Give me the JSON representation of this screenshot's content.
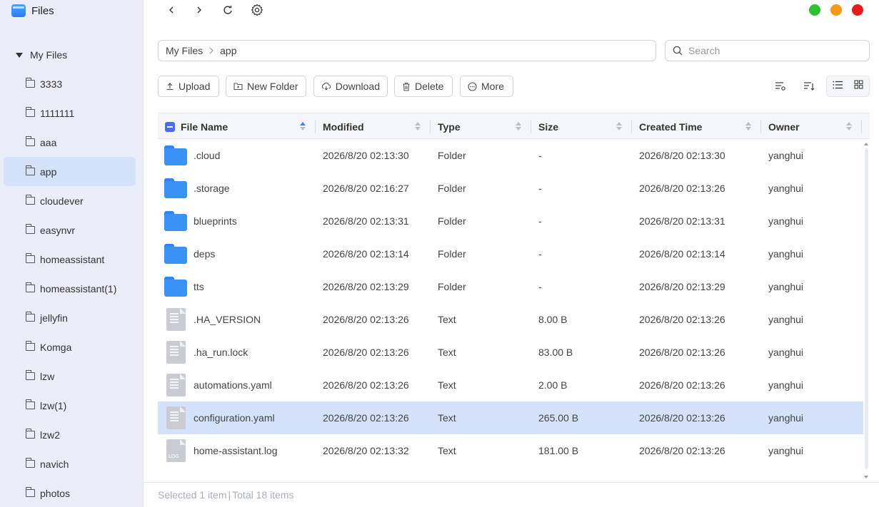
{
  "app": {
    "title": "Files"
  },
  "window_controls": [
    {
      "name": "green",
      "color": "#2fc02f"
    },
    {
      "name": "orange",
      "color": "#f59a16"
    },
    {
      "name": "red",
      "color": "#e81b1b"
    }
  ],
  "sidebar": {
    "root_label": "My Files",
    "items": [
      {
        "label": "3333",
        "active": false
      },
      {
        "label": "1111111",
        "active": false
      },
      {
        "label": "aaa",
        "active": false
      },
      {
        "label": "app",
        "active": true
      },
      {
        "label": "cloudever",
        "active": false
      },
      {
        "label": "easynvr",
        "active": false
      },
      {
        "label": "homeassistant",
        "active": false
      },
      {
        "label": "homeassistant(1)",
        "active": false
      },
      {
        "label": "jellyfin",
        "active": false
      },
      {
        "label": "Komga",
        "active": false
      },
      {
        "label": "lzw",
        "active": false
      },
      {
        "label": "lzw(1)",
        "active": false
      },
      {
        "label": "lzw2",
        "active": false
      },
      {
        "label": "navich",
        "active": false
      },
      {
        "label": "photos",
        "active": false
      }
    ]
  },
  "breadcrumb": {
    "root": "My Files",
    "current": "app"
  },
  "search": {
    "placeholder": "Search",
    "value": ""
  },
  "actions": {
    "upload": "Upload",
    "new_folder": "New Folder",
    "download": "Download",
    "delete": "Delete",
    "more": "More"
  },
  "table": {
    "columns": {
      "name": "File Name",
      "modified": "Modified",
      "type": "Type",
      "size": "Size",
      "created": "Created Time",
      "owner": "Owner"
    },
    "rows": [
      {
        "name": ".cloud",
        "modified": "2026/8/20 02:13:30",
        "type": "Folder",
        "size": "-",
        "created": "2026/8/20 02:13:30",
        "owner": "yanghui",
        "icon": "folder-icon"
      },
      {
        "name": ".storage",
        "modified": "2026/8/20 02:16:27",
        "type": "Folder",
        "size": "-",
        "created": "2026/8/20 02:13:26",
        "owner": "yanghui",
        "icon": "folder-icon"
      },
      {
        "name": "blueprints",
        "modified": "2026/8/20 02:13:31",
        "type": "Folder",
        "size": "-",
        "created": "2026/8/20 02:13:31",
        "owner": "yanghui",
        "icon": "folder-icon"
      },
      {
        "name": "deps",
        "modified": "2026/8/20 02:13:14",
        "type": "Folder",
        "size": "-",
        "created": "2026/8/20 02:13:14",
        "owner": "yanghui",
        "icon": "folder-icon"
      },
      {
        "name": "tts",
        "modified": "2026/8/20 02:13:29",
        "type": "Folder",
        "size": "-",
        "created": "2026/8/20 02:13:29",
        "owner": "yanghui",
        "icon": "folder-icon"
      },
      {
        "name": ".HA_VERSION",
        "modified": "2026/8/20 02:13:26",
        "type": "Text",
        "size": "8.00 B",
        "created": "2026/8/20 02:13:26",
        "owner": "yanghui",
        "icon": "text-file-icon"
      },
      {
        "name": ".ha_run.lock",
        "modified": "2026/8/20 02:13:26",
        "type": "Text",
        "size": "83.00 B",
        "created": "2026/8/20 02:13:26",
        "owner": "yanghui",
        "icon": "text-file-icon"
      },
      {
        "name": "automations.yaml",
        "modified": "2026/8/20 02:13:26",
        "type": "Text",
        "size": "2.00 B",
        "created": "2026/8/20 02:13:26",
        "owner": "yanghui",
        "icon": "text-file-icon"
      },
      {
        "name": "configuration.yaml",
        "modified": "2026/8/20 02:13:26",
        "type": "Text",
        "size": "265.00 B",
        "created": "2026/8/20 02:13:26",
        "owner": "yanghui",
        "icon": "text-file-icon",
        "selected": true
      },
      {
        "name": "home-assistant.log",
        "modified": "2026/8/20 02:13:32",
        "type": "Text",
        "size": "181.00 B",
        "created": "2026/8/20 02:13:26",
        "owner": "yanghui",
        "icon": "log-file-icon",
        "tag": "LOG"
      }
    ]
  },
  "footer": {
    "selected": "Selected 1 item",
    "total": "Total 18 items"
  }
}
